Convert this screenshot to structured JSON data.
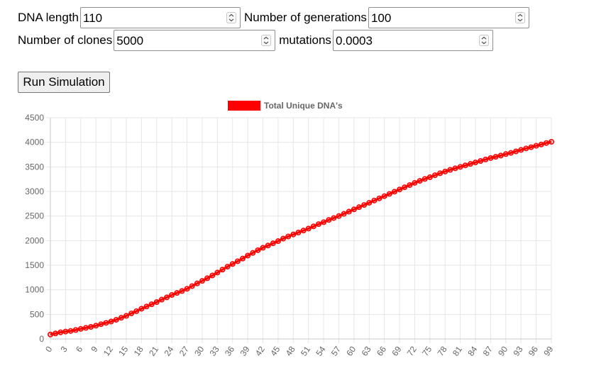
{
  "controls": {
    "dna_length": {
      "label": "DNA length",
      "value": "110"
    },
    "generations": {
      "label": "Number of generations",
      "value": "100"
    },
    "clones": {
      "label": "Number of clones",
      "value": "5000"
    },
    "mutations": {
      "label": "mutations",
      "value": "0.0003"
    },
    "run_label": "Run Simulation"
  },
  "colors": {
    "series": "#ff0000",
    "grid": "#e6e6e6",
    "axis": "#666666"
  },
  "chart_data": {
    "type": "line",
    "title": "",
    "xlabel": "",
    "ylabel": "",
    "legend": {
      "position": "top-center"
    },
    "grid": true,
    "ylim": [
      0,
      4500
    ],
    "xlim": [
      0,
      99
    ],
    "y_ticks": [
      "0",
      "500",
      "1000",
      "1500",
      "2000",
      "2500",
      "3000",
      "3500",
      "4000",
      "4500"
    ],
    "x_ticks": [
      "0",
      "3",
      "6",
      "9",
      "12",
      "15",
      "18",
      "21",
      "24",
      "27",
      "30",
      "33",
      "36",
      "39",
      "42",
      "45",
      "48",
      "51",
      "54",
      "57",
      "60",
      "63",
      "66",
      "69",
      "72",
      "75",
      "78",
      "81",
      "84",
      "87",
      "90",
      "93",
      "96",
      "99"
    ],
    "x": [
      0,
      1,
      2,
      3,
      4,
      5,
      6,
      7,
      8,
      9,
      10,
      11,
      12,
      13,
      14,
      15,
      16,
      17,
      18,
      19,
      20,
      21,
      22,
      23,
      24,
      25,
      26,
      27,
      28,
      29,
      30,
      31,
      32,
      33,
      34,
      35,
      36,
      37,
      38,
      39,
      40,
      41,
      42,
      43,
      44,
      45,
      46,
      47,
      48,
      49,
      50,
      51,
      52,
      53,
      54,
      55,
      56,
      57,
      58,
      59,
      60,
      61,
      62,
      63,
      64,
      65,
      66,
      67,
      68,
      69,
      70,
      71,
      72,
      73,
      74,
      75,
      76,
      77,
      78,
      79,
      80,
      81,
      82,
      83,
      84,
      85,
      86,
      87,
      88,
      89,
      90,
      91,
      92,
      93,
      94,
      95,
      96,
      97,
      98,
      99
    ],
    "series": [
      {
        "name": "Total Unique DNA's",
        "values": [
          90,
          112,
          135,
          150,
          163,
          182,
          205,
          225,
          245,
          270,
          300,
          327,
          355,
          390,
          430,
          470,
          520,
          565,
          615,
          660,
          705,
          750,
          800,
          845,
          895,
          935,
          975,
          1020,
          1075,
          1130,
          1180,
          1235,
          1290,
          1350,
          1410,
          1470,
          1525,
          1580,
          1635,
          1695,
          1750,
          1805,
          1855,
          1900,
          1945,
          1990,
          2040,
          2085,
          2125,
          2165,
          2205,
          2245,
          2290,
          2335,
          2375,
          2420,
          2460,
          2500,
          2545,
          2590,
          2635,
          2680,
          2725,
          2770,
          2815,
          2860,
          2905,
          2950,
          2995,
          3040,
          3085,
          3130,
          3175,
          3215,
          3255,
          3290,
          3330,
          3370,
          3405,
          3440,
          3470,
          3500,
          3530,
          3560,
          3590,
          3620,
          3650,
          3680,
          3705,
          3730,
          3760,
          3785,
          3815,
          3845,
          3875,
          3900,
          3930,
          3955,
          3985,
          4010
        ]
      }
    ]
  }
}
